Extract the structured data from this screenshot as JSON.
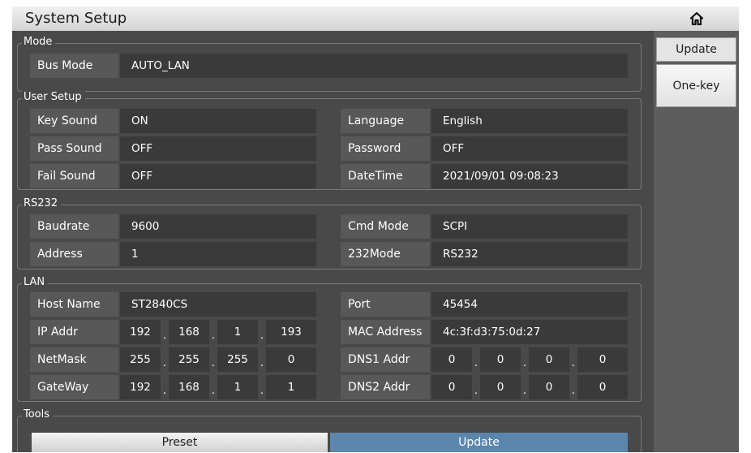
{
  "window": {
    "title": "System Setup"
  },
  "icons": {
    "home": "home-icon"
  },
  "sidebar": {
    "update_label": "Update",
    "onekey_label": "One-key"
  },
  "mode": {
    "section": "Mode",
    "bus_mode": {
      "label": "Bus Mode",
      "value": "AUTO_LAN"
    }
  },
  "user": {
    "section": "User Setup",
    "key_sound": {
      "label": "Key Sound",
      "value": "ON"
    },
    "pass_sound": {
      "label": "Pass Sound",
      "value": "OFF"
    },
    "fail_sound": {
      "label": "Fail Sound",
      "value": "OFF"
    },
    "language": {
      "label": "Language",
      "value": "English"
    },
    "password": {
      "label": "Password",
      "value": "OFF"
    },
    "datetime": {
      "label": "DateTime",
      "value": "2021/09/01 09:08:23"
    }
  },
  "rs232": {
    "section": "RS232",
    "baudrate": {
      "label": "Baudrate",
      "value": "9600"
    },
    "address": {
      "label": "Address",
      "value": "1"
    },
    "cmd_mode": {
      "label": "Cmd Mode",
      "value": "SCPI"
    },
    "mode232": {
      "label": "232Mode",
      "value": "RS232"
    }
  },
  "lan": {
    "section": "LAN",
    "host_name": {
      "label": "Host Name",
      "value": "ST2840CS"
    },
    "ip_addr": {
      "label": "IP Addr",
      "octets": [
        "192",
        "168",
        "1",
        "193"
      ]
    },
    "netmask": {
      "label": "NetMask",
      "octets": [
        "255",
        "255",
        "255",
        "0"
      ]
    },
    "gateway": {
      "label": "GateWay",
      "octets": [
        "192",
        "168",
        "1",
        "1"
      ]
    },
    "port": {
      "label": "Port",
      "value": "45454"
    },
    "mac": {
      "label": "MAC Address",
      "value": "4c:3f:d3:75:0d:27"
    },
    "dns1": {
      "label": "DNS1 Addr",
      "octets": [
        "0",
        "0",
        "0",
        "0"
      ]
    },
    "dns2": {
      "label": "DNS2 Addr",
      "octets": [
        "0",
        "0",
        "0",
        "0"
      ]
    },
    "separator": "."
  },
  "tools": {
    "section": "Tools",
    "preset_label": "Preset",
    "update_label": "Update"
  }
}
